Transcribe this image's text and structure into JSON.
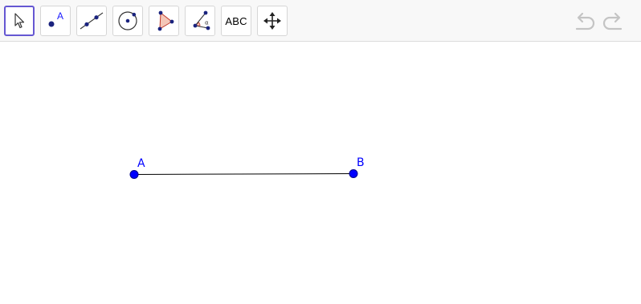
{
  "toolbar": {
    "tools": [
      {
        "name": "move",
        "icon": "cursor-arrow-icon",
        "selected": true
      },
      {
        "name": "point",
        "icon": "point-icon",
        "label": "A"
      },
      {
        "name": "line",
        "icon": "line-through-two-points-icon"
      },
      {
        "name": "circle",
        "icon": "circle-with-center-icon"
      },
      {
        "name": "polygon",
        "icon": "polygon-icon"
      },
      {
        "name": "angle",
        "icon": "angle-icon",
        "label": "α"
      },
      {
        "name": "text",
        "icon": "text-tool-icon",
        "label": "ABC"
      },
      {
        "name": "move-graphics-view",
        "icon": "move-arrows-icon"
      }
    ],
    "undo_icon": "undo-icon",
    "redo_icon": "redo-icon"
  },
  "colors": {
    "accent": "#6557d2",
    "point": "#0000ff",
    "point_stroke": "#00008b",
    "segment": "#000000",
    "polygon_fill": "#f4c7b8"
  },
  "construction": {
    "points": [
      {
        "label": "A"
      },
      {
        "label": "B"
      }
    ],
    "segment": {
      "from": "A",
      "to": "B"
    }
  }
}
